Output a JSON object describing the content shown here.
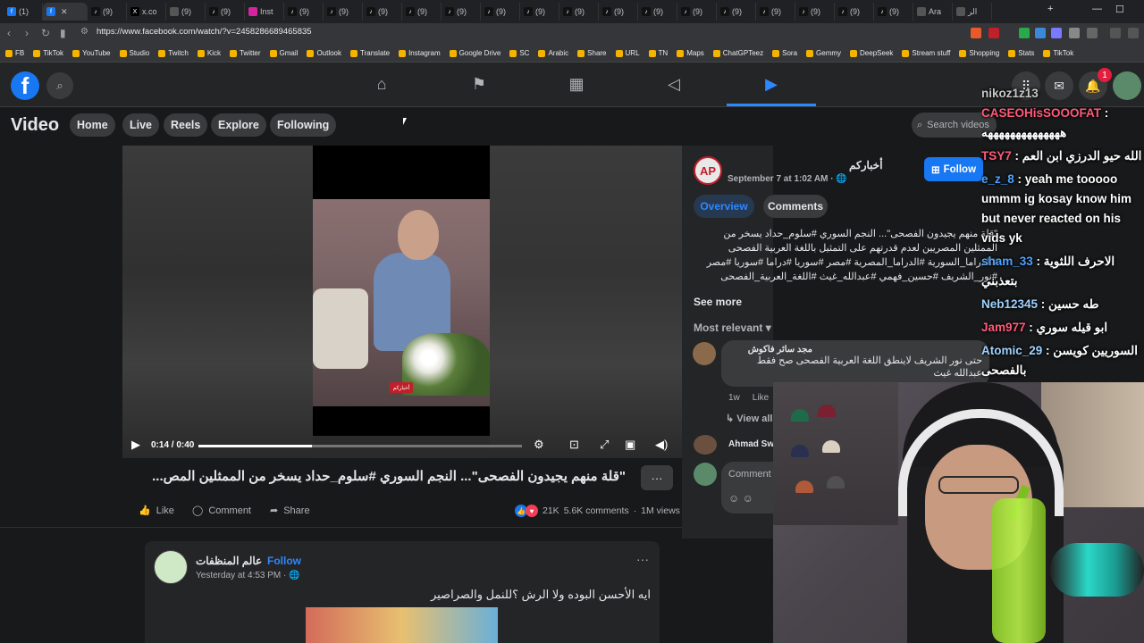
{
  "browser": {
    "tabs": [
      {
        "label": "(1)",
        "icon": "facebook-icon"
      },
      {
        "label": "",
        "icon": "facebook-icon",
        "active": true
      },
      {
        "label": "(9)",
        "icon": "tiktok-icon"
      },
      {
        "label": "x.co",
        "icon": "x-icon"
      },
      {
        "label": "(9)",
        "icon": "tab-icon"
      },
      {
        "label": "(9)",
        "icon": "tiktok-icon"
      },
      {
        "label": "Inst",
        "icon": "instagram-icon"
      },
      {
        "label": "(9)",
        "icon": "tiktok-icon"
      },
      {
        "label": "(9)",
        "icon": "tiktok-icon"
      },
      {
        "label": "(9)",
        "icon": "tiktok-icon"
      },
      {
        "label": "(9)",
        "icon": "tiktok-icon"
      },
      {
        "label": "(9)",
        "icon": "tiktok-icon"
      },
      {
        "label": "(9)",
        "icon": "tiktok-icon"
      },
      {
        "label": "(9)",
        "icon": "tiktok-icon"
      },
      {
        "label": "(9)",
        "icon": "tiktok-icon"
      },
      {
        "label": "(9)",
        "icon": "tiktok-icon"
      },
      {
        "label": "(9)",
        "icon": "tiktok-icon"
      },
      {
        "label": "(9)",
        "icon": "tiktok-icon"
      },
      {
        "label": "(9)",
        "icon": "tiktok-icon"
      },
      {
        "label": "(9)",
        "icon": "tiktok-icon"
      },
      {
        "label": "(9)",
        "icon": "tiktok-icon"
      },
      {
        "label": "(9)",
        "icon": "tiktok-icon"
      },
      {
        "label": "(9)",
        "icon": "tiktok-icon"
      },
      {
        "label": "Ara",
        "icon": "tab-icon"
      },
      {
        "label": "الر",
        "icon": "tab-icon"
      }
    ],
    "new_tab": "+",
    "minimize": "—",
    "maximize": "☐",
    "close": "✕",
    "url": "https://www.facebook.com/watch/?v=2458286689465835",
    "bookmarks": [
      "FB",
      "TikTok",
      "YouTube",
      "Studio",
      "Twitch",
      "Kick",
      "Twitter",
      "Gmail",
      "Outlook",
      "Translate",
      "Instagram",
      "Google Drive",
      "SC",
      "Arabic",
      "Share",
      "URL",
      "TN",
      "Maps",
      "ChatGPTeez",
      "Sora",
      "Gemmy",
      "DeepSeek",
      "Stream stuff",
      "Shopping",
      "Stats",
      "TikTok"
    ]
  },
  "fb": {
    "logo": "f",
    "notif_count": "1",
    "section_title": "Video",
    "subnav": [
      "Home",
      "Live",
      "Reels",
      "Explore",
      "Following"
    ],
    "search_placeholder": "Search videos"
  },
  "video": {
    "channel_badge": "أخباركم",
    "time": "0:14 / 0:40",
    "progress": 0.35,
    "title": "\"قلة منهم يجيدون الفصحى\"... النجم السوري #سلوم_حداد يسخر من الممثلين المص...",
    "like": "Like",
    "comment": "Comment",
    "share": "Share",
    "reactions": "21K",
    "comments_count": "5.6K comments",
    "views": "1M views"
  },
  "post2": {
    "name": "عالم المنظفات",
    "follow": "Follow",
    "time": "Yesterday at 4:53 PM",
    "text": "ايه الأحسن البوده ولا الرش ؟للنمل والصراصير"
  },
  "panel": {
    "page_name": "أخباركم",
    "date": "September 7 at 1:02 AM",
    "follow": "Follow",
    "tab_overview": "Overview",
    "tab_comments": "Comments",
    "description": "\"قلة منهم يجيدون الفصحى\"... النجم السوري #سلوم_حداد يسخر من الممثلين المصريين لعدم قدرتهم على التمثيل باللغة العربية الفصحى #الدراما_السورية #الدراما_المصرية #مصر #سوريا #دراما #سوريا #مصر #نور_الشريف #حسين_فهمي #عبدالله_غيث #اللغة_العربية_الفصحى",
    "see_more": "See more",
    "most_relevant": "Most relevant",
    "comment1_name": "مجد سائر فاكوش",
    "comment1_text": "حتى نور الشريف لاينطق اللغة العربية الفصحى صح فقط عبدالله غيث",
    "comment1_time": "1w",
    "comment1_like": "Like",
    "view_all": "View all 4",
    "comment2_name": "Ahmad Sw",
    "comment_placeholder": "Comment"
  },
  "chat": [
    {
      "user": "nikoz1z13",
      "msg": "",
      "color": "#c8c8c8"
    },
    {
      "user": "CASEOHisSOOOFAT",
      "msg": ": ههههههههههههههه",
      "color": "#ff5a7a"
    },
    {
      "user": "TSY7",
      "msg": ": الله حيو الدرزي ابن العم",
      "color": "#ff5a7a"
    },
    {
      "user": "e_z_8",
      "msg": ": yeah me tooooo ummm ig kosay know him but never reacted on his vids yk",
      "color": "#4da3ff"
    },
    {
      "user": "sham_33",
      "msg": ": الاحرف اللثوية بتعذبني",
      "color": "#4da3ff"
    },
    {
      "user": "Neb12345",
      "msg": ": طه حسين",
      "color": "#9fd2ff"
    },
    {
      "user": "Jam977",
      "msg": ": ابو قيله سوري",
      "color": "#ff5a7a"
    },
    {
      "user": "Atomic_29",
      "msg": ": السوريين كويسن بالفصحى",
      "color": "#9fd2ff"
    }
  ],
  "colors": {
    "fb_blue": "#1877f2",
    "accent": "#2d88ff",
    "bg": "#18191a",
    "surface": "#242526"
  }
}
